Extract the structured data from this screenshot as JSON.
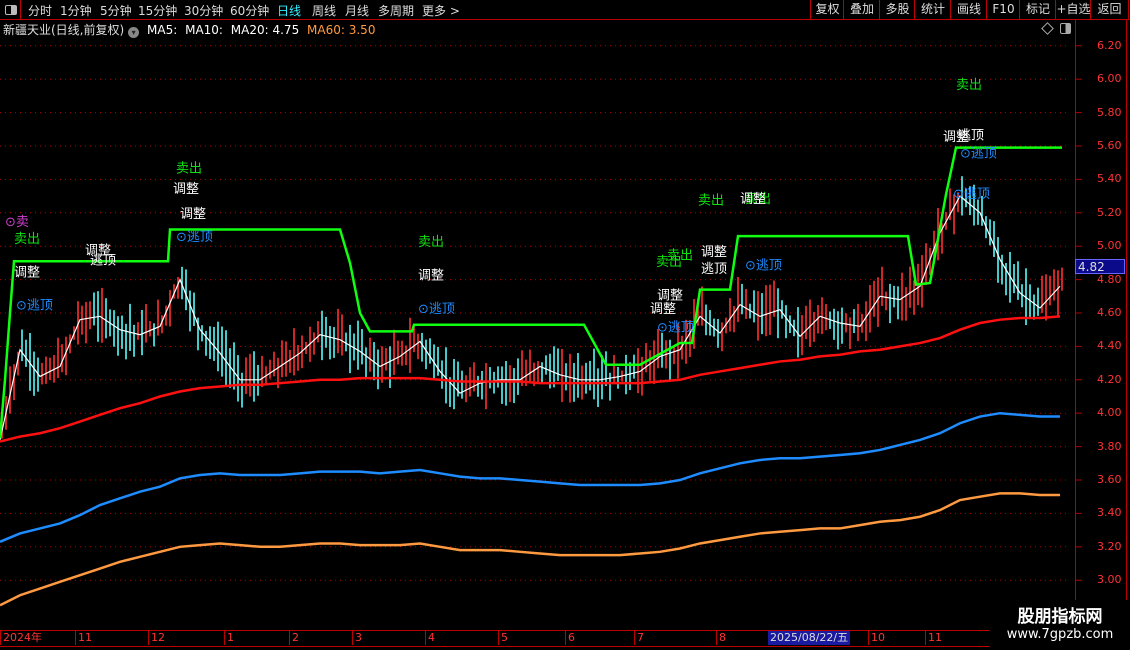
{
  "toolbar": {
    "periods": [
      "分时",
      "1分钟",
      "5分钟",
      "15分钟",
      "30分钟",
      "60分钟",
      "日线",
      "周线",
      "月线",
      "多周期",
      "更多 >"
    ],
    "active_period": "日线",
    "buttons": [
      "复权",
      "叠加",
      "多股",
      "统计",
      "画线",
      "F10",
      "标记",
      "+自选",
      "返回"
    ]
  },
  "info": {
    "stock": "新疆天业(日线,前复权)",
    "ma5": "MA5:",
    "ma10": "MA10:",
    "ma20": "MA20: 4.75",
    "ma60": "MA60: 3.50"
  },
  "current_price": "4.82",
  "x_axis": {
    "labels": [
      "2024年",
      "11",
      "12",
      "1",
      "2",
      "3",
      "4",
      "5",
      "6",
      "7",
      "8",
      "10",
      "11"
    ],
    "highlight_date": "2025/08/22/五"
  },
  "watermark": {
    "line1": "股朋指标网",
    "line2": "www.7gpzb.com"
  },
  "colors": {
    "up": "#ff3030",
    "down": "#54fcfc",
    "white": "#ffffff",
    "red": "#ff1010",
    "blue": "#1e8cff",
    "orange": "#ff9a40",
    "green": "#10ff10",
    "grid": "#b00000"
  },
  "chart_data": {
    "type": "line",
    "title": "新疆天业(日线,前复权)",
    "ylim": [
      2.9,
      6.3
    ],
    "yticks": [
      "6.20",
      "6.00",
      "5.80",
      "5.60",
      "5.40",
      "5.20",
      "5.00",
      "4.80",
      "4.60",
      "4.40",
      "4.20",
      "4.00",
      "3.80",
      "3.60",
      "3.40",
      "3.20",
      "3.00"
    ],
    "x_label_index": [
      0,
      3.75,
      7.4,
      11.2,
      14.45,
      17.6,
      21.25,
      24.9,
      28.25,
      31.7,
      35.8,
      43.4,
      46.25
    ],
    "sample_count": 54,
    "series": [
      {
        "name": "MA5",
        "color": "white",
        "values": [
          3.84,
          4.38,
          4.22,
          4.28,
          4.56,
          4.58,
          4.5,
          4.47,
          4.52,
          4.8,
          4.5,
          4.36,
          4.2,
          4.2,
          4.28,
          4.36,
          4.47,
          4.44,
          4.37,
          4.28,
          4.34,
          4.43,
          4.25,
          4.12,
          4.18,
          4.2,
          4.2,
          4.28,
          4.23,
          4.2,
          4.2,
          4.22,
          4.25,
          4.34,
          4.38,
          4.58,
          4.48,
          4.65,
          4.58,
          4.62,
          4.46,
          4.58,
          4.54,
          4.52,
          4.7,
          4.68,
          4.76,
          5.08,
          5.3,
          5.2,
          4.92,
          4.72,
          4.63,
          4.76
        ]
      },
      {
        "name": "MA20",
        "color": "red",
        "values": [
          3.83,
          3.86,
          3.88,
          3.91,
          3.95,
          3.99,
          4.03,
          4.06,
          4.1,
          4.13,
          4.15,
          4.16,
          4.17,
          4.17,
          4.18,
          4.19,
          4.2,
          4.2,
          4.21,
          4.21,
          4.21,
          4.21,
          4.2,
          4.19,
          4.19,
          4.19,
          4.19,
          4.18,
          4.18,
          4.18,
          4.18,
          4.18,
          4.18,
          4.19,
          4.2,
          4.23,
          4.25,
          4.27,
          4.29,
          4.31,
          4.32,
          4.34,
          4.35,
          4.37,
          4.38,
          4.4,
          4.42,
          4.45,
          4.5,
          4.54,
          4.56,
          4.57,
          4.57,
          4.58
        ]
      },
      {
        "name": "BandMid",
        "color": "blue",
        "values": [
          3.23,
          3.28,
          3.31,
          3.34,
          3.39,
          3.45,
          3.49,
          3.53,
          3.56,
          3.61,
          3.63,
          3.64,
          3.63,
          3.63,
          3.63,
          3.64,
          3.65,
          3.65,
          3.65,
          3.64,
          3.65,
          3.66,
          3.64,
          3.62,
          3.61,
          3.61,
          3.6,
          3.59,
          3.58,
          3.57,
          3.57,
          3.57,
          3.57,
          3.58,
          3.6,
          3.64,
          3.67,
          3.7,
          3.72,
          3.73,
          3.73,
          3.74,
          3.75,
          3.76,
          3.78,
          3.81,
          3.84,
          3.88,
          3.94,
          3.98,
          4.0,
          3.99,
          3.98,
          3.98
        ]
      },
      {
        "name": "MA60",
        "color": "orange",
        "values": [
          2.85,
          2.91,
          2.95,
          2.99,
          3.03,
          3.07,
          3.11,
          3.14,
          3.17,
          3.2,
          3.21,
          3.22,
          3.21,
          3.2,
          3.2,
          3.21,
          3.22,
          3.22,
          3.21,
          3.21,
          3.21,
          3.22,
          3.2,
          3.18,
          3.18,
          3.18,
          3.17,
          3.16,
          3.15,
          3.15,
          3.15,
          3.15,
          3.16,
          3.17,
          3.19,
          3.22,
          3.24,
          3.26,
          3.28,
          3.29,
          3.3,
          3.31,
          3.31,
          3.33,
          3.35,
          3.36,
          3.38,
          3.42,
          3.48,
          3.5,
          3.52,
          3.52,
          3.51,
          3.51
        ]
      }
    ],
    "stop_line": {
      "name": "止损线",
      "color": "green",
      "points": [
        [
          0,
          3.85
        ],
        [
          0.25,
          4.2
        ],
        [
          0.5,
          4.6
        ],
        [
          0.7,
          4.91
        ],
        [
          8.4,
          4.91
        ],
        [
          8.5,
          5.1
        ],
        [
          17,
          5.1
        ],
        [
          17.5,
          4.9
        ],
        [
          18,
          4.6
        ],
        [
          18.5,
          4.49
        ],
        [
          19.1,
          4.49
        ],
        [
          20.6,
          4.49
        ],
        [
          20.7,
          4.53
        ],
        [
          29.2,
          4.53
        ],
        [
          30.3,
          4.29
        ],
        [
          32,
          4.29
        ],
        [
          34,
          4.42
        ],
        [
          34.6,
          4.42
        ],
        [
          35,
          4.74
        ],
        [
          36.5,
          4.74
        ],
        [
          36.9,
          5.06
        ],
        [
          45.4,
          5.06
        ],
        [
          45.8,
          4.77
        ],
        [
          46.5,
          4.78
        ],
        [
          47.3,
          5.31
        ],
        [
          47.8,
          5.59
        ],
        [
          53.1,
          5.59
        ]
      ]
    },
    "annotations": [
      {
        "text": "⊙卖",
        "color": "#d040d0",
        "i": 0.25,
        "p": 5.15
      },
      {
        "text": "卖出",
        "color": "#10e010",
        "i": 0.7,
        "p": 5.05
      },
      {
        "text": "调整",
        "color": "#ffffff",
        "i": 0.7,
        "p": 4.85
      },
      {
        "text": "⊙逃顶",
        "color": "#1e8cff",
        "i": 0.8,
        "p": 4.65
      },
      {
        "text": "调整",
        "color": "#ffffff",
        "i": 4.25,
        "p": 4.98
      },
      {
        "text": "逃顶",
        "color": "#ffffff",
        "i": 4.5,
        "p": 4.92
      },
      {
        "text": "卖出",
        "color": "#10e010",
        "i": 8.8,
        "p": 5.47
      },
      {
        "text": "调整",
        "color": "#ffffff",
        "i": 8.65,
        "p": 5.35
      },
      {
        "text": "调整",
        "color": "#ffffff",
        "i": 9.0,
        "p": 5.2
      },
      {
        "text": "⊙逃顶",
        "color": "#1e8cff",
        "i": 8.8,
        "p": 5.06
      },
      {
        "text": "卖出",
        "color": "#10e010",
        "i": 20.9,
        "p": 5.03
      },
      {
        "text": "调整",
        "color": "#ffffff",
        "i": 20.9,
        "p": 4.83
      },
      {
        "text": "⊙逃顶",
        "color": "#1e8cff",
        "i": 20.9,
        "p": 4.63
      },
      {
        "text": "卖出",
        "color": "#10e010",
        "i": 33.35,
        "p": 4.95
      },
      {
        "text": "卖出",
        "color": "#10e010",
        "i": 32.8,
        "p": 4.91
      },
      {
        "text": "调整",
        "color": "#ffffff",
        "i": 35.05,
        "p": 4.97
      },
      {
        "text": "逃顶",
        "color": "#ffffff",
        "i": 35.05,
        "p": 4.87
      },
      {
        "text": "调整",
        "color": "#ffffff",
        "i": 32.85,
        "p": 4.71
      },
      {
        "text": "调整",
        "color": "#ffffff",
        "i": 32.5,
        "p": 4.63
      },
      {
        "text": "⊙逃顶",
        "color": "#1e8cff",
        "i": 32.85,
        "p": 4.52
      },
      {
        "text": "卖出",
        "color": "#10e010",
        "i": 34.9,
        "p": 5.28
      },
      {
        "text": "卖出",
        "color": "#10e010",
        "i": 37.25,
        "p": 5.29
      },
      {
        "text": "调整",
        "color": "#ffffff",
        "i": 37.0,
        "p": 5.29
      },
      {
        "text": "⊙逃顶",
        "color": "#1e8cff",
        "i": 37.25,
        "p": 4.89
      },
      {
        "text": "卖出",
        "color": "#10e010",
        "i": 47.8,
        "p": 5.97
      },
      {
        "text": "调整",
        "color": "#ffffff",
        "i": 47.15,
        "p": 5.66
      },
      {
        "text": "逃顶",
        "color": "#ffffff",
        "i": 47.9,
        "p": 5.67
      },
      {
        "text": "⊙逃顶",
        "color": "#1e8cff",
        "i": 48.0,
        "p": 5.56
      },
      {
        "text": "⊙逃顶",
        "color": "#1e8cff",
        "i": 47.65,
        "p": 5.32
      }
    ]
  }
}
